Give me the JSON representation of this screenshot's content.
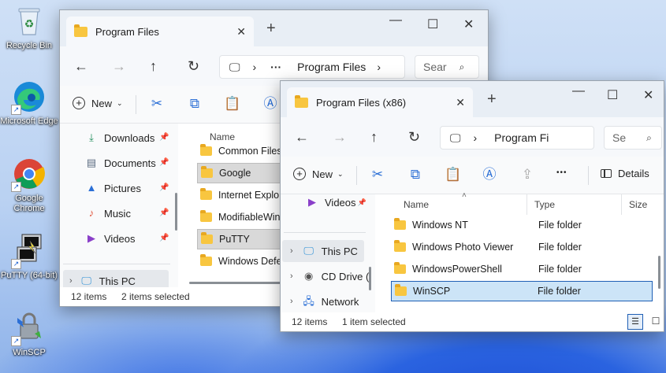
{
  "desktop": {
    "icons": [
      {
        "label": "Recycle Bin",
        "icon": "recycle-bin-icon"
      },
      {
        "label": "Microsoft Edge",
        "icon": "edge-icon"
      },
      {
        "label": "Google Chrome",
        "icon": "chrome-icon"
      },
      {
        "label": "PuTTY (64-bit)",
        "icon": "putty-icon"
      },
      {
        "label": "WinSCP",
        "icon": "winscp-icon"
      }
    ]
  },
  "window1": {
    "tab_title": "Program Files",
    "address": {
      "more": "···",
      "folder": "Program Files",
      "chevron": "›"
    },
    "search_placeholder": "Sear",
    "toolbar": {
      "new_label": "New"
    },
    "nav_items": [
      {
        "label": "Downloads",
        "icon": "download-icon",
        "pinned": true
      },
      {
        "label": "Documents",
        "icon": "documents-icon",
        "pinned": true
      },
      {
        "label": "Pictures",
        "icon": "pictures-icon",
        "pinned": true
      },
      {
        "label": "Music",
        "icon": "music-icon",
        "pinned": true
      },
      {
        "label": "Videos",
        "icon": "videos-icon",
        "pinned": true
      },
      {
        "label": "This PC",
        "icon": "this-pc-icon",
        "pinned": false
      }
    ],
    "columns": {
      "name": "Name"
    },
    "rows": [
      {
        "name": "Common Files",
        "selected": false
      },
      {
        "name": "Google",
        "selected": true
      },
      {
        "name": "Internet Explorer",
        "selected": false
      },
      {
        "name": "ModifiableWindowsApps",
        "selected": false
      },
      {
        "name": "PuTTY",
        "selected": true
      },
      {
        "name": "Windows Defender",
        "selected": false
      }
    ],
    "status": {
      "count": "12 items",
      "selection": "2 items selected"
    }
  },
  "window2": {
    "tab_title": "Program Files (x86)",
    "address": {
      "folder": "Program Fi"
    },
    "search_placeholder": "Se",
    "toolbar": {
      "new_label": "New",
      "more": "•••",
      "details_label": "Details"
    },
    "nav_items": [
      {
        "label": "Videos",
        "icon": "videos-icon"
      },
      {
        "label": "This PC",
        "icon": "this-pc-icon"
      },
      {
        "label": "CD Drive (",
        "icon": "cd-drive-icon"
      },
      {
        "label": "Network",
        "icon": "network-icon"
      }
    ],
    "columns": {
      "name": "Name",
      "type": "Type",
      "size": "Size"
    },
    "rows": [
      {
        "name": "Windows NT",
        "type": "File folder",
        "selected": false
      },
      {
        "name": "Windows Photo Viewer",
        "type": "File folder",
        "selected": false
      },
      {
        "name": "WindowsPowerShell",
        "type": "File folder",
        "selected": false
      },
      {
        "name": "WinSCP",
        "type": "File folder",
        "selected": true
      }
    ],
    "status": {
      "count": "12 items",
      "selection": "1 item selected"
    }
  },
  "colors": {
    "accent": "#2b6fd6",
    "folder": "#f8c640",
    "selection": "#cce4f7",
    "selection_border": "#1f5fb5"
  }
}
